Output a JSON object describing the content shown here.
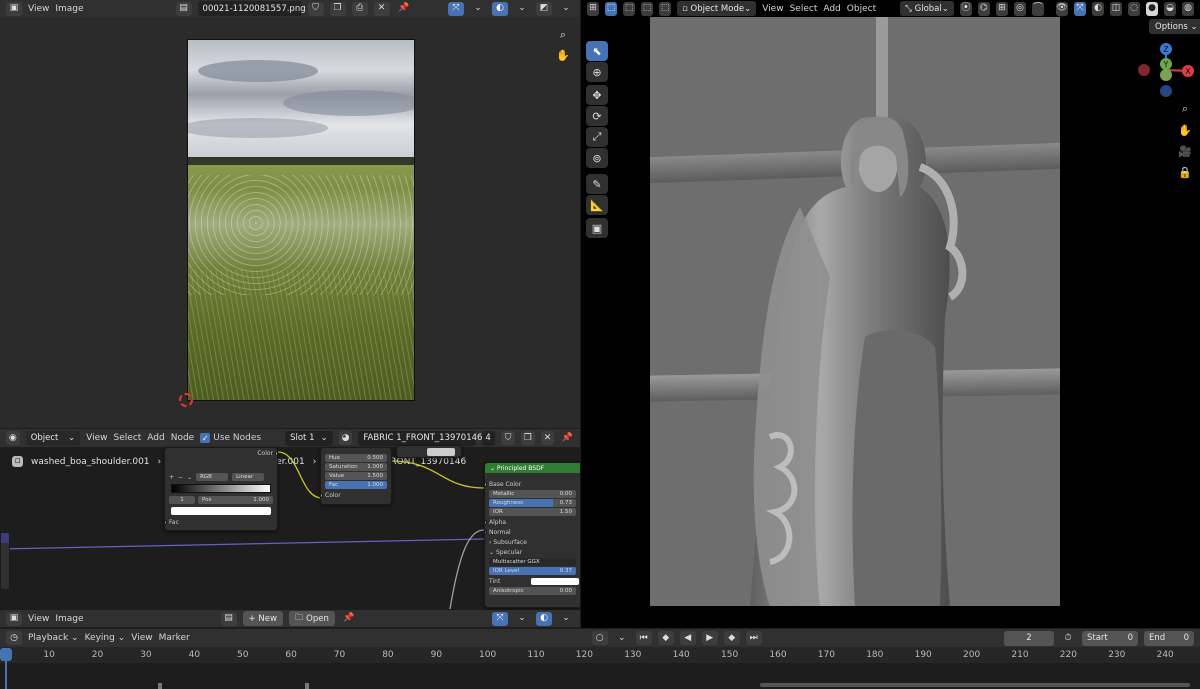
{
  "image_editor": {
    "menus": [
      "View",
      "Image"
    ],
    "image_name": "00021-1120081557.png"
  },
  "viewport": {
    "mode": "Object Mode",
    "menus": [
      "View",
      "Select",
      "Add",
      "Object"
    ],
    "orientation": "Global",
    "options_label": "Options",
    "gizmo_axes": [
      "Z",
      "Y",
      "X"
    ]
  },
  "node_editor": {
    "type": "Object",
    "menus": [
      "View",
      "Select",
      "Add",
      "Node"
    ],
    "use_nodes_label": "Use Nodes",
    "use_nodes_checked": true,
    "slot": "Slot 1",
    "material_name": "FABRIC 1_FRONT_13970146",
    "material_users": "4",
    "breadcrumbs": [
      "washed_boa_shoulder.001",
      "washed_boa_shoulder.001",
      "FABRIC 1_FRONT_13970146"
    ],
    "colorramp_node": {
      "color_out": "Color",
      "mode": "RGB",
      "interp": "Linear",
      "index": "1",
      "pos_label": "Pos",
      "pos_value": "1.000",
      "fac_label": "Fac"
    },
    "hsv_node": {
      "hue_label": "Hue",
      "hue_value": "0.500",
      "saturation_label": "Saturation",
      "saturation_value": "1.000",
      "value_label": "Value",
      "value_value": "1.500",
      "fac_label": "Fac",
      "fac_value": "1.000",
      "color_label": "Color"
    },
    "bsdf_node": {
      "title": "Principled BSDF",
      "base_color": "Base Color",
      "metallic_label": "Metallic",
      "metallic_value": "0.00",
      "roughness_label": "Roughness",
      "roughness_value": "0.73",
      "roughness_fraction": 0.73,
      "ior_label": "IOR",
      "ior_value": "1.50",
      "alpha": "Alpha",
      "normal": "Normal",
      "subsurface": "Subsurface",
      "specular": "Specular",
      "multiscatter": "Multiscatter GGX",
      "ior_level_label": "IOR Level",
      "ior_level_value": "0.37",
      "tint_label": "Tint",
      "anisotropic_label": "Anisotropic",
      "anisotropic_value": "0.00"
    }
  },
  "image_editor2": {
    "menus": [
      "View",
      "Image"
    ],
    "new_label": "New",
    "open_label": "Open"
  },
  "timeline": {
    "playback": "Playback",
    "keying": "Keying",
    "view": "View",
    "marker": "Marker",
    "current_frame": "2",
    "start_label": "Start",
    "start_value": "0",
    "end_label": "End",
    "end_value": "0",
    "ticks": [
      "2",
      "10",
      "20",
      "30",
      "40",
      "50",
      "60",
      "70",
      "80",
      "90",
      "100",
      "110",
      "120",
      "130",
      "140",
      "150",
      "160",
      "170",
      "180",
      "190",
      "200",
      "210",
      "220",
      "230",
      "240"
    ]
  },
  "colors": {
    "accent": "#4772b3",
    "header": "#303030",
    "socket_yellow": "#c7c729",
    "bsdf_header": "#2e7d32"
  }
}
